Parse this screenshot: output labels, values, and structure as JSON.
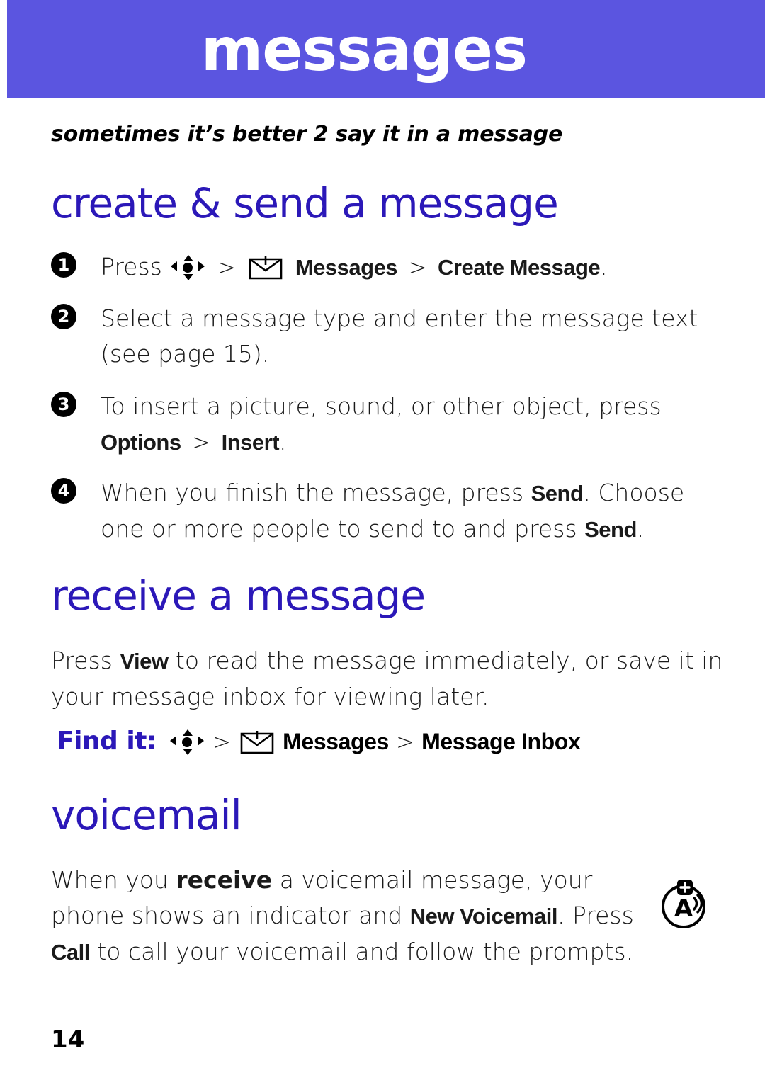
{
  "header": {
    "title": "messages",
    "banner_color": "#5b55e0"
  },
  "tagline": "sometimes it’s better 2 say it in a message",
  "sections": {
    "create": {
      "heading": "create & send a message",
      "steps": [
        {
          "number": "1",
          "lead": "Press",
          "nav_icon": "navigation-key-icon",
          "sep1": ">",
          "menu_icon": "envelope-icon",
          "path1": "Messages",
          "sep2": ">",
          "path2": "Create Message",
          "tail": "."
        },
        {
          "number": "2",
          "text": "Select a message type and enter the message text (see page 15)."
        },
        {
          "number": "3",
          "text_before": "To insert a picture, sound, or other object, press ",
          "path1": "Options",
          "sep": ">",
          "path2": "Insert",
          "tail": "."
        },
        {
          "number": "4",
          "text_before": "When you finish the message, press ",
          "key1": "Send",
          "text_middle": ". Choose one or more people to send to and press ",
          "key2": "Send",
          "tail": "."
        }
      ]
    },
    "receive": {
      "heading": "receive a message",
      "paragraph_before": "Press ",
      "key": "View",
      "paragraph_after": " to read the message immediately, or save it in your message inbox for viewing later.",
      "find_it": {
        "label": "Find it:",
        "nav_icon": "navigation-key-icon",
        "sep1": ">",
        "menu_icon": "envelope-icon",
        "path1": "Messages",
        "sep2": ">",
        "path2": "Message Inbox"
      }
    },
    "voicemail": {
      "heading": "voicemail",
      "text_1": "When you ",
      "bold_1": "receive",
      "text_2": " a voicemail message, your phone shows an indicator and ",
      "bold_2": "New Voicemail",
      "text_3": ". Press ",
      "bold_3": "Call",
      "text_4": " to call your voicemail and follow the prompts.",
      "badge_icon": "voicemail-indicator-icon"
    }
  },
  "page_number": "14",
  "colors": {
    "heading_blue": "#2b18b8",
    "banner_purple": "#5b55e0",
    "text": "#1a1a1a"
  }
}
